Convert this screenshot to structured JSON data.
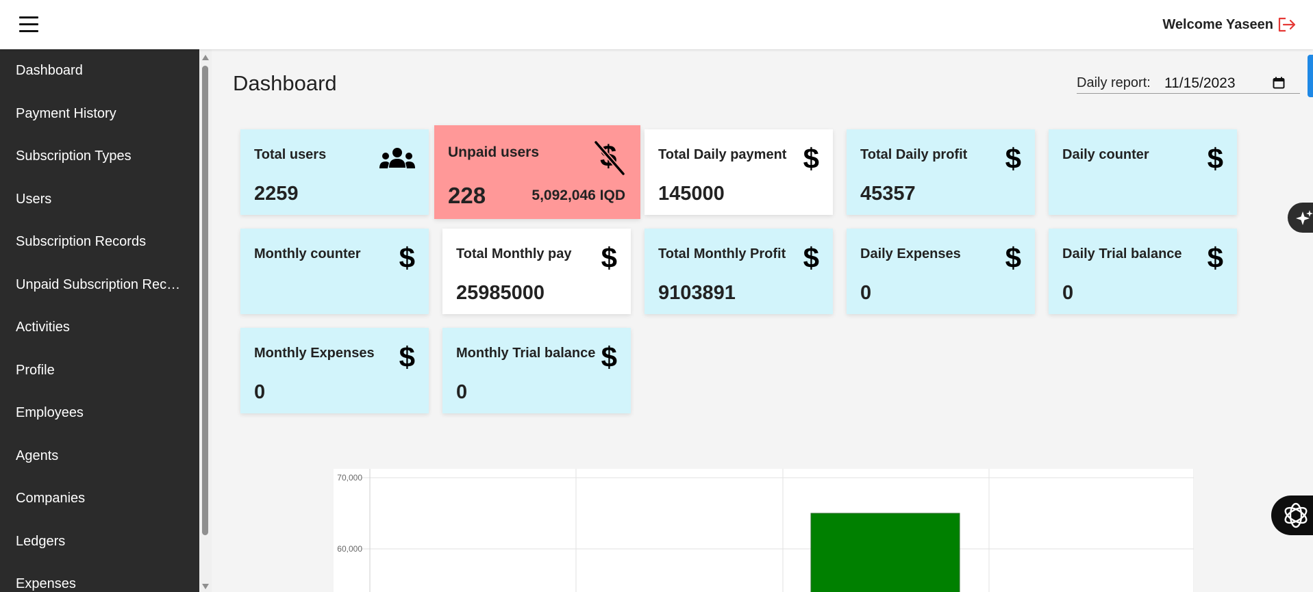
{
  "header": {
    "welcome": "Welcome Yaseen"
  },
  "sidebar": {
    "items": [
      {
        "label": "Dashboard"
      },
      {
        "label": "Payment History"
      },
      {
        "label": "Subscription Types"
      },
      {
        "label": "Users"
      },
      {
        "label": "Subscription Records"
      },
      {
        "label": "Unpaid Subscription Reco..."
      },
      {
        "label": "Activities"
      },
      {
        "label": "Profile"
      },
      {
        "label": "Employees"
      },
      {
        "label": "Agents"
      },
      {
        "label": "Companies"
      },
      {
        "label": "Ledgers"
      },
      {
        "label": "Expenses"
      }
    ]
  },
  "page": {
    "title": "Dashboard",
    "daily_report_label": "Daily report:",
    "daily_report_value": "11/15/2023"
  },
  "cards": [
    {
      "title": "Total users",
      "value": "2259",
      "icon": "users-icon"
    },
    {
      "title": "Unpaid users",
      "value": "228",
      "extra": "5,092,046 IQD",
      "icon": "dollar-off-icon"
    },
    {
      "title": "Total Daily payment",
      "value": "145000",
      "icon": "dollar-icon"
    },
    {
      "title": "Total Daily profit",
      "value": "45357",
      "icon": "dollar-icon"
    },
    {
      "title": "Daily counter",
      "value": "",
      "icon": "dollar-icon"
    },
    {
      "title": "Monthly counter",
      "value": "",
      "icon": "dollar-icon"
    },
    {
      "title": "Total Monthly pay",
      "value": "25985000",
      "icon": "dollar-icon"
    },
    {
      "title": "Total Monthly Profit",
      "value": "9103891",
      "icon": "dollar-icon"
    },
    {
      "title": "Daily Expenses",
      "value": "0",
      "icon": "dollar-icon"
    },
    {
      "title": "Daily Trial balance",
      "value": "0",
      "icon": "dollar-icon"
    },
    {
      "title": "Monthly Expenses",
      "value": "0",
      "icon": "dollar-icon"
    },
    {
      "title": "Monthly Trial balance",
      "value": "0",
      "icon": "dollar-icon"
    }
  ],
  "colors": {
    "sidebar_bg": "#2b2b2b",
    "card_blue": "#d2f4fb",
    "card_red": "#ff9898",
    "bar_green": "#008000",
    "logout_red": "#e53935"
  },
  "chart_data": {
    "type": "bar",
    "y_ticks": [
      "70,000",
      "60,000"
    ],
    "ylim": [
      50000,
      70000
    ],
    "values": [
      65000
    ],
    "bar_color": "#008000"
  }
}
